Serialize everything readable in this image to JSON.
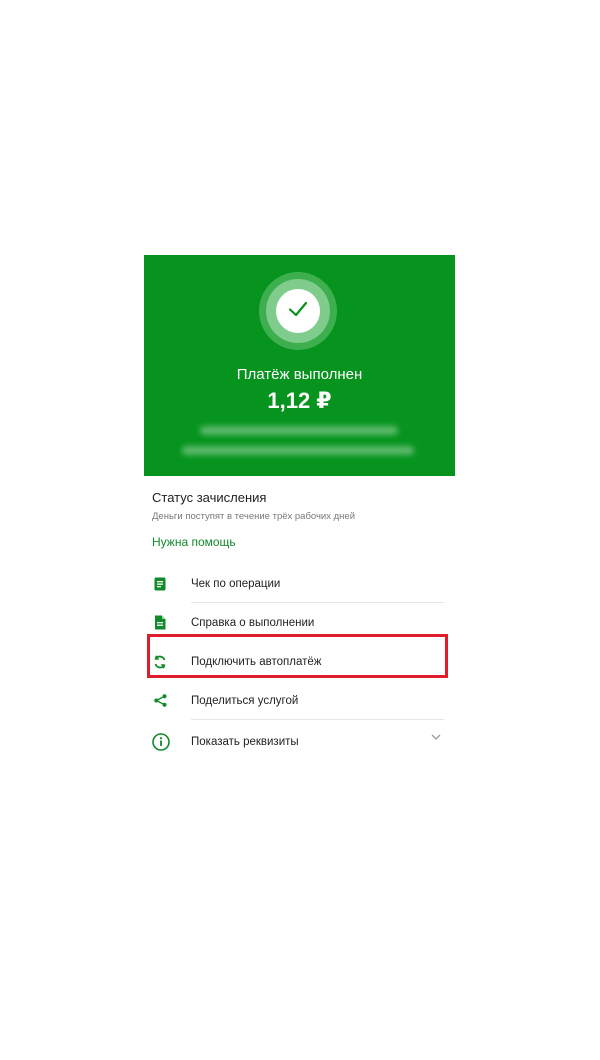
{
  "header": {
    "title": "Платёж выполнен",
    "amount": "1,12 ₽"
  },
  "status": {
    "title": "Статус зачисления",
    "subtitle": "Деньги поступят в течение трёх рабочих дней",
    "help_link": "Нужна помощь"
  },
  "actions": [
    {
      "label": "Чек по операции",
      "icon": "receipt-icon"
    },
    {
      "label": "Справка о выполнении",
      "icon": "document-icon"
    },
    {
      "label": "Подключить автоплатёж",
      "icon": "autopay-refresh-icon"
    },
    {
      "label": "Поделиться услугой",
      "icon": "share-icon"
    },
    {
      "label": "Показать реквизиты",
      "icon": "info-icon"
    }
  ],
  "colors": {
    "brand_green": "#06941e",
    "link_green": "#118a2a",
    "highlight_red": "#e11d2b"
  }
}
